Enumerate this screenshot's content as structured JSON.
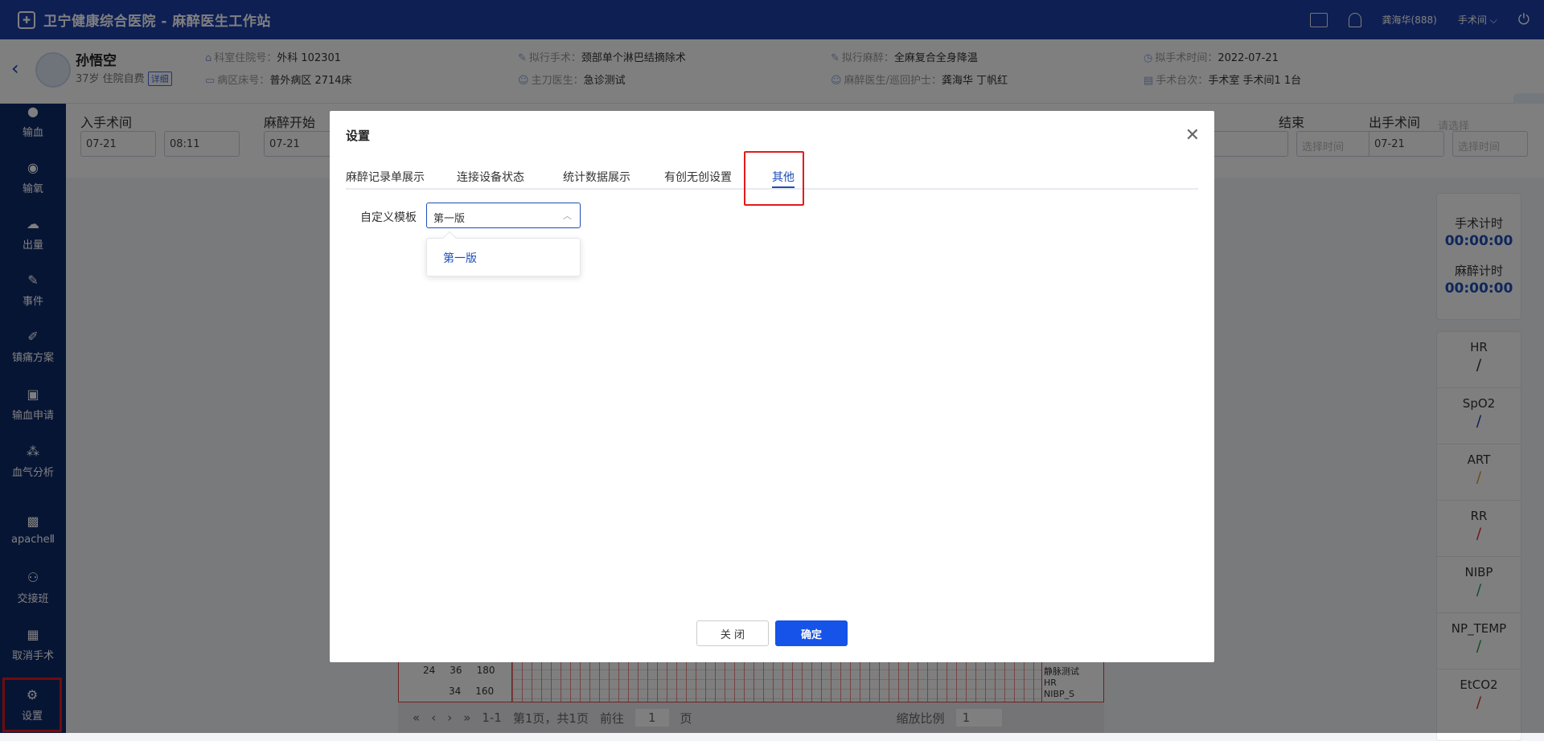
{
  "topbar": {
    "title": "卫宁健康综合医院 - 麻醉医生工作站",
    "user": "龚海华(888)",
    "room": "手术间"
  },
  "patient": {
    "name": "孙悟空",
    "age_status": "37岁 住院自费",
    "detail_badge": "详细",
    "fields": [
      {
        "k": "科室住院号：",
        "v": "外科 102301"
      },
      {
        "k": "病区床号：",
        "v": "普外病区 2714床"
      },
      {
        "k": "拟行手术：",
        "v": "颈部单个淋巴结摘除术"
      },
      {
        "k": "主刀医生：",
        "v": "急诊测试"
      },
      {
        "k": "拟行麻醉：",
        "v": "全麻复合全身降温"
      },
      {
        "k": "麻醉医生/巡回护士：",
        "v": "龚海华 丁帆红"
      },
      {
        "k": "拟手术时间：",
        "v": "2022-07-21"
      },
      {
        "k": "手术台次：",
        "v": "手术室 手术间1 1台"
      }
    ]
  },
  "sidebar": [
    {
      "label": "输血",
      "icon": "drop-icon"
    },
    {
      "label": "输氧",
      "icon": "oxygen-icon"
    },
    {
      "label": "出量",
      "icon": "output-icon"
    },
    {
      "label": "事件",
      "icon": "event-icon"
    },
    {
      "label": "镇痛方案",
      "icon": "analgesia-icon"
    },
    {
      "label": "输血申请",
      "icon": "transfusion-request-icon"
    },
    {
      "label": "血气分析",
      "icon": "blood-gas-icon"
    },
    {
      "label": "apacheⅡ",
      "icon": "apache-icon"
    },
    {
      "label": "交接班",
      "icon": "handover-icon"
    },
    {
      "label": "取消手术",
      "icon": "cancel-surgery-icon"
    },
    {
      "label": "设置",
      "icon": "settings-icon"
    }
  ],
  "phases": {
    "enter": {
      "label": "入手术间",
      "date": "07-21",
      "time": "08:11"
    },
    "anes_start": {
      "label": "麻醉开始",
      "date": "07-21"
    },
    "end": {
      "label": "结束",
      "date_ph": "",
      "time_ph": "选择时间"
    },
    "leave": {
      "label": "出手术间",
      "select_ph": "请选择",
      "date": "07-21",
      "time_ph": "选择时间"
    }
  },
  "timers": {
    "op_label": "手术计时",
    "op_value": "00:00:00",
    "anes_label": "麻醉计时",
    "anes_value": "00:00:00"
  },
  "vitals": [
    {
      "name": "HR",
      "color": "#333333"
    },
    {
      "name": "SpO2",
      "color": "#1c3fa8"
    },
    {
      "name": "ART",
      "color": "#e59a2b"
    },
    {
      "name": "RR",
      "color": "#d33"
    },
    {
      "name": "NIBP",
      "color": "#2a9d5c"
    },
    {
      "name": "NP_TEMP",
      "color": "#2a9d5c"
    },
    {
      "name": "EtCO2",
      "color": "#d33"
    }
  ],
  "grid": {
    "r1": [
      "24",
      "36",
      "180"
    ],
    "r2": [
      "",
      "34",
      "160"
    ],
    "legend1": "静脉测试",
    "legend2": "HR",
    "legend3": "NIBP_S"
  },
  "pager": {
    "range": "1-1",
    "page_info": "第1页，共1页",
    "goto": "前往",
    "page_val": "1",
    "page_unit": "页",
    "zoom_label": "缩放比例",
    "zoom_val": "1"
  },
  "modal": {
    "title": "设置",
    "tabs": [
      "麻醉记录单展示",
      "连接设备状态",
      "统计数据展示",
      "有创无创设置",
      "其他"
    ],
    "field_label": "自定义模板",
    "select_value": "第一版",
    "option": "第一版",
    "cancel": "关 闭",
    "confirm": "确定"
  }
}
